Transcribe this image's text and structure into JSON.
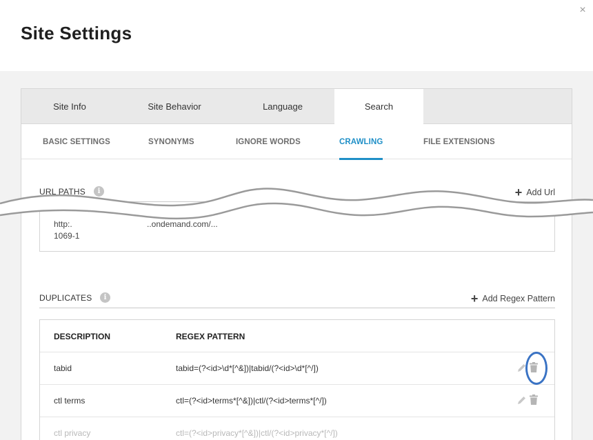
{
  "dialog": {
    "title": "Site Settings",
    "close_glyph": "×"
  },
  "main_tabs": [
    {
      "label": "Site Info",
      "active": false
    },
    {
      "label": "Site Behavior",
      "active": false
    },
    {
      "label": "Language",
      "active": false
    },
    {
      "label": "Search",
      "active": true
    }
  ],
  "sub_tabs": [
    {
      "label": "BASIC SETTINGS",
      "active": false
    },
    {
      "label": "SYNONYMS",
      "active": false
    },
    {
      "label": "IGNORE WORDS",
      "active": false
    },
    {
      "label": "CRAWLING",
      "active": true
    },
    {
      "label": "FILE EXTENSIONS",
      "active": false
    }
  ],
  "url_paths": {
    "title": "URL PATHS",
    "info_glyph": "i",
    "add_plus": "+",
    "add_label": "Add Url",
    "row_fragment_a": "http:.",
    "row_fragment_b": "..ondemand.com/...",
    "row_fragment_c": "1069-1"
  },
  "duplicates": {
    "title": "DUPLICATES",
    "info_glyph": "i",
    "add_plus": "+",
    "add_label": "Add Regex Pattern",
    "columns": {
      "description": "DESCRIPTION",
      "pattern": "REGEX PATTERN"
    },
    "rows": [
      {
        "description": "tabid",
        "pattern": "tabid=(?<id>\\d*[^&])|tabid/(?<id>\\d*[^/])"
      },
      {
        "description": "ctl terms",
        "pattern": "ctl=(?<id>terms*[^&])|ctl/(?<id>terms*[^/])"
      },
      {
        "description": "ctl privacy",
        "pattern": "ctl=(?<id>privacy*[^&])|ctl/(?<id>privacy*[^/])"
      }
    ]
  },
  "colors": {
    "accent": "#1f8fc7",
    "highlight": "#3a73c4",
    "tab_bar": "#e9e9e9",
    "page_bg": "#f2f2f2"
  },
  "icons": {
    "close": "close-icon",
    "info": "info-icon",
    "add": "plus-icon",
    "edit": "pencil-icon",
    "delete": "trash-icon"
  }
}
